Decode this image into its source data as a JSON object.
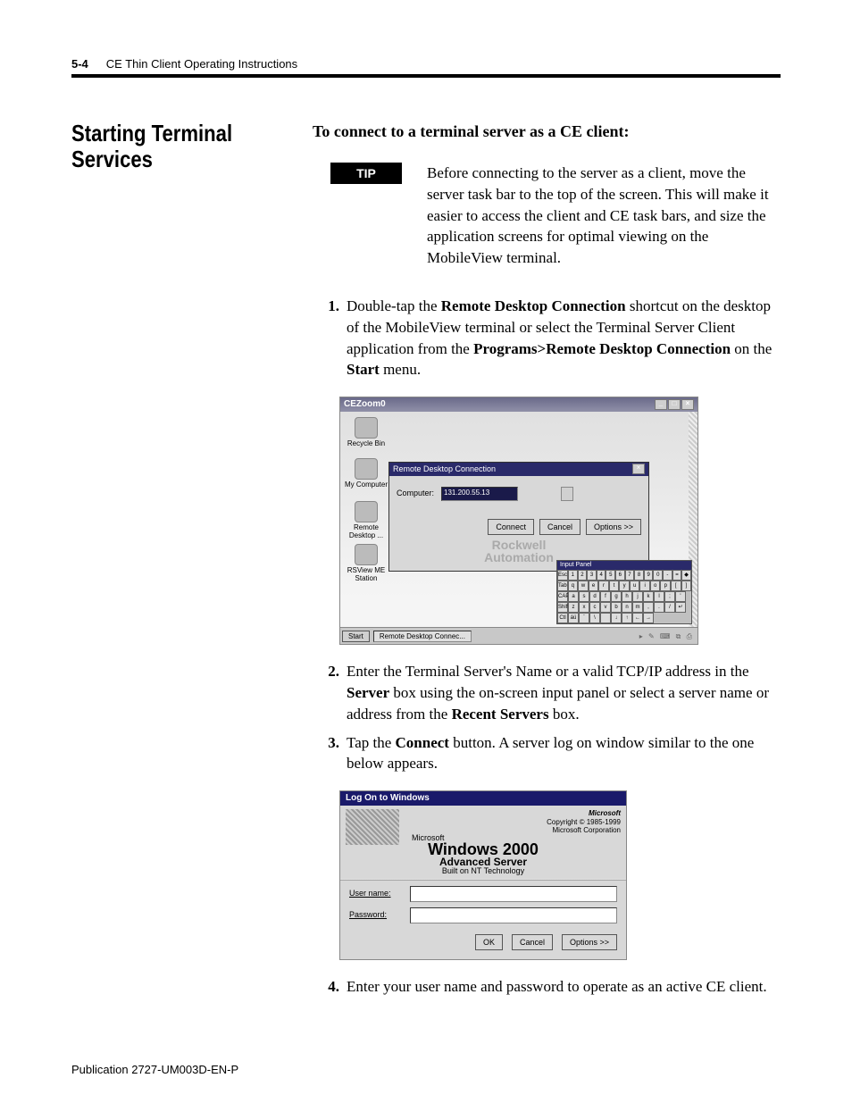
{
  "header": {
    "page_number": "5-4",
    "title": "CE Thin Client Operating Instructions"
  },
  "footer": {
    "publication": "Publication 2727-UM003D-EN-P"
  },
  "section": {
    "heading": "Starting Terminal Services",
    "intro": "To connect to a terminal server as a CE client:",
    "tip_label": "TIP",
    "tip_text": "Before connecting to the server as a client, move the server task bar to the top of the screen. This will make it easier to access the client and CE task bars, and size the application screens for optimal viewing on the MobileView terminal.",
    "step1_num": "1.",
    "step1_a": "Double-tap the ",
    "step1_b": "Remote Desktop Connection",
    "step1_c": " shortcut on the desktop of the MobileView terminal or select the Terminal Server Client application from the ",
    "step1_d": "Programs>Remote Desktop Connection",
    "step1_e": " on the ",
    "step1_f": "Start",
    "step1_g": " menu.",
    "step2_num": "2.",
    "step2_a": "Enter the Terminal Server's Name or a valid TCP/IP address in the ",
    "step2_b": "Server",
    "step2_c": " box using the on-screen input panel or select a server name or address from the ",
    "step2_d": "Recent Servers",
    "step2_e": " box.",
    "step3_num": "3.",
    "step3_a": "Tap the ",
    "step3_b": "Connect",
    "step3_c": " button. A server log on window similar to the one below appears.",
    "step4_num": "4.",
    "step4": "Enter your user name and password to operate as an active CE client."
  },
  "fig1": {
    "window_title": "CEZoom0",
    "icons": {
      "recycle": "Recycle Bin",
      "mycomp": "My Computer",
      "remote": "Remote Desktop ...",
      "rsview": "RSView ME Station"
    },
    "dialog_title": "Remote Desktop Connection",
    "computer_label": "Computer:",
    "computer_value": "131.200.55.13",
    "connect": "Connect",
    "cancel": "Cancel",
    "options": "Options >>",
    "brand1": "Rockwell",
    "brand2": "Automation",
    "input_panel_title": "Input Panel",
    "kbd_r1": [
      "Esc",
      "1",
      "2",
      "3",
      "4",
      "5",
      "6",
      "7",
      "8",
      "9",
      "0",
      "-",
      "=",
      "◆"
    ],
    "kbd_r2": [
      "Tab",
      "q",
      "w",
      "e",
      "r",
      "t",
      "y",
      "u",
      "i",
      "o",
      "p",
      "[",
      "]"
    ],
    "kbd_r3": [
      "CAP",
      "a",
      "s",
      "d",
      "f",
      "g",
      "h",
      "j",
      "k",
      "l",
      ";",
      "'"
    ],
    "kbd_r4": [
      "Shift",
      "z",
      "x",
      "c",
      "v",
      "b",
      "n",
      "m",
      ",",
      ".",
      "/",
      "↵"
    ],
    "kbd_r5": [
      "Ctl",
      "áü",
      "`",
      "\\",
      " ",
      "↓",
      "↑",
      "←",
      "→"
    ],
    "start": "Start",
    "task_item": "Remote Desktop Connec..."
  },
  "fig2": {
    "title": "Log On to Windows",
    "ms": "Microsoft",
    "copyright": "Copyright © 1985-1999",
    "corp": "Microsoft Corporation",
    "ms_small": "Microsoft",
    "win_line1": "Windows 2000",
    "win_line2": "Advanced Server",
    "built": "Built on NT Technology",
    "username": "User name:",
    "password": "Password:",
    "ok": "OK",
    "cancel": "Cancel",
    "options": "Options >>"
  }
}
